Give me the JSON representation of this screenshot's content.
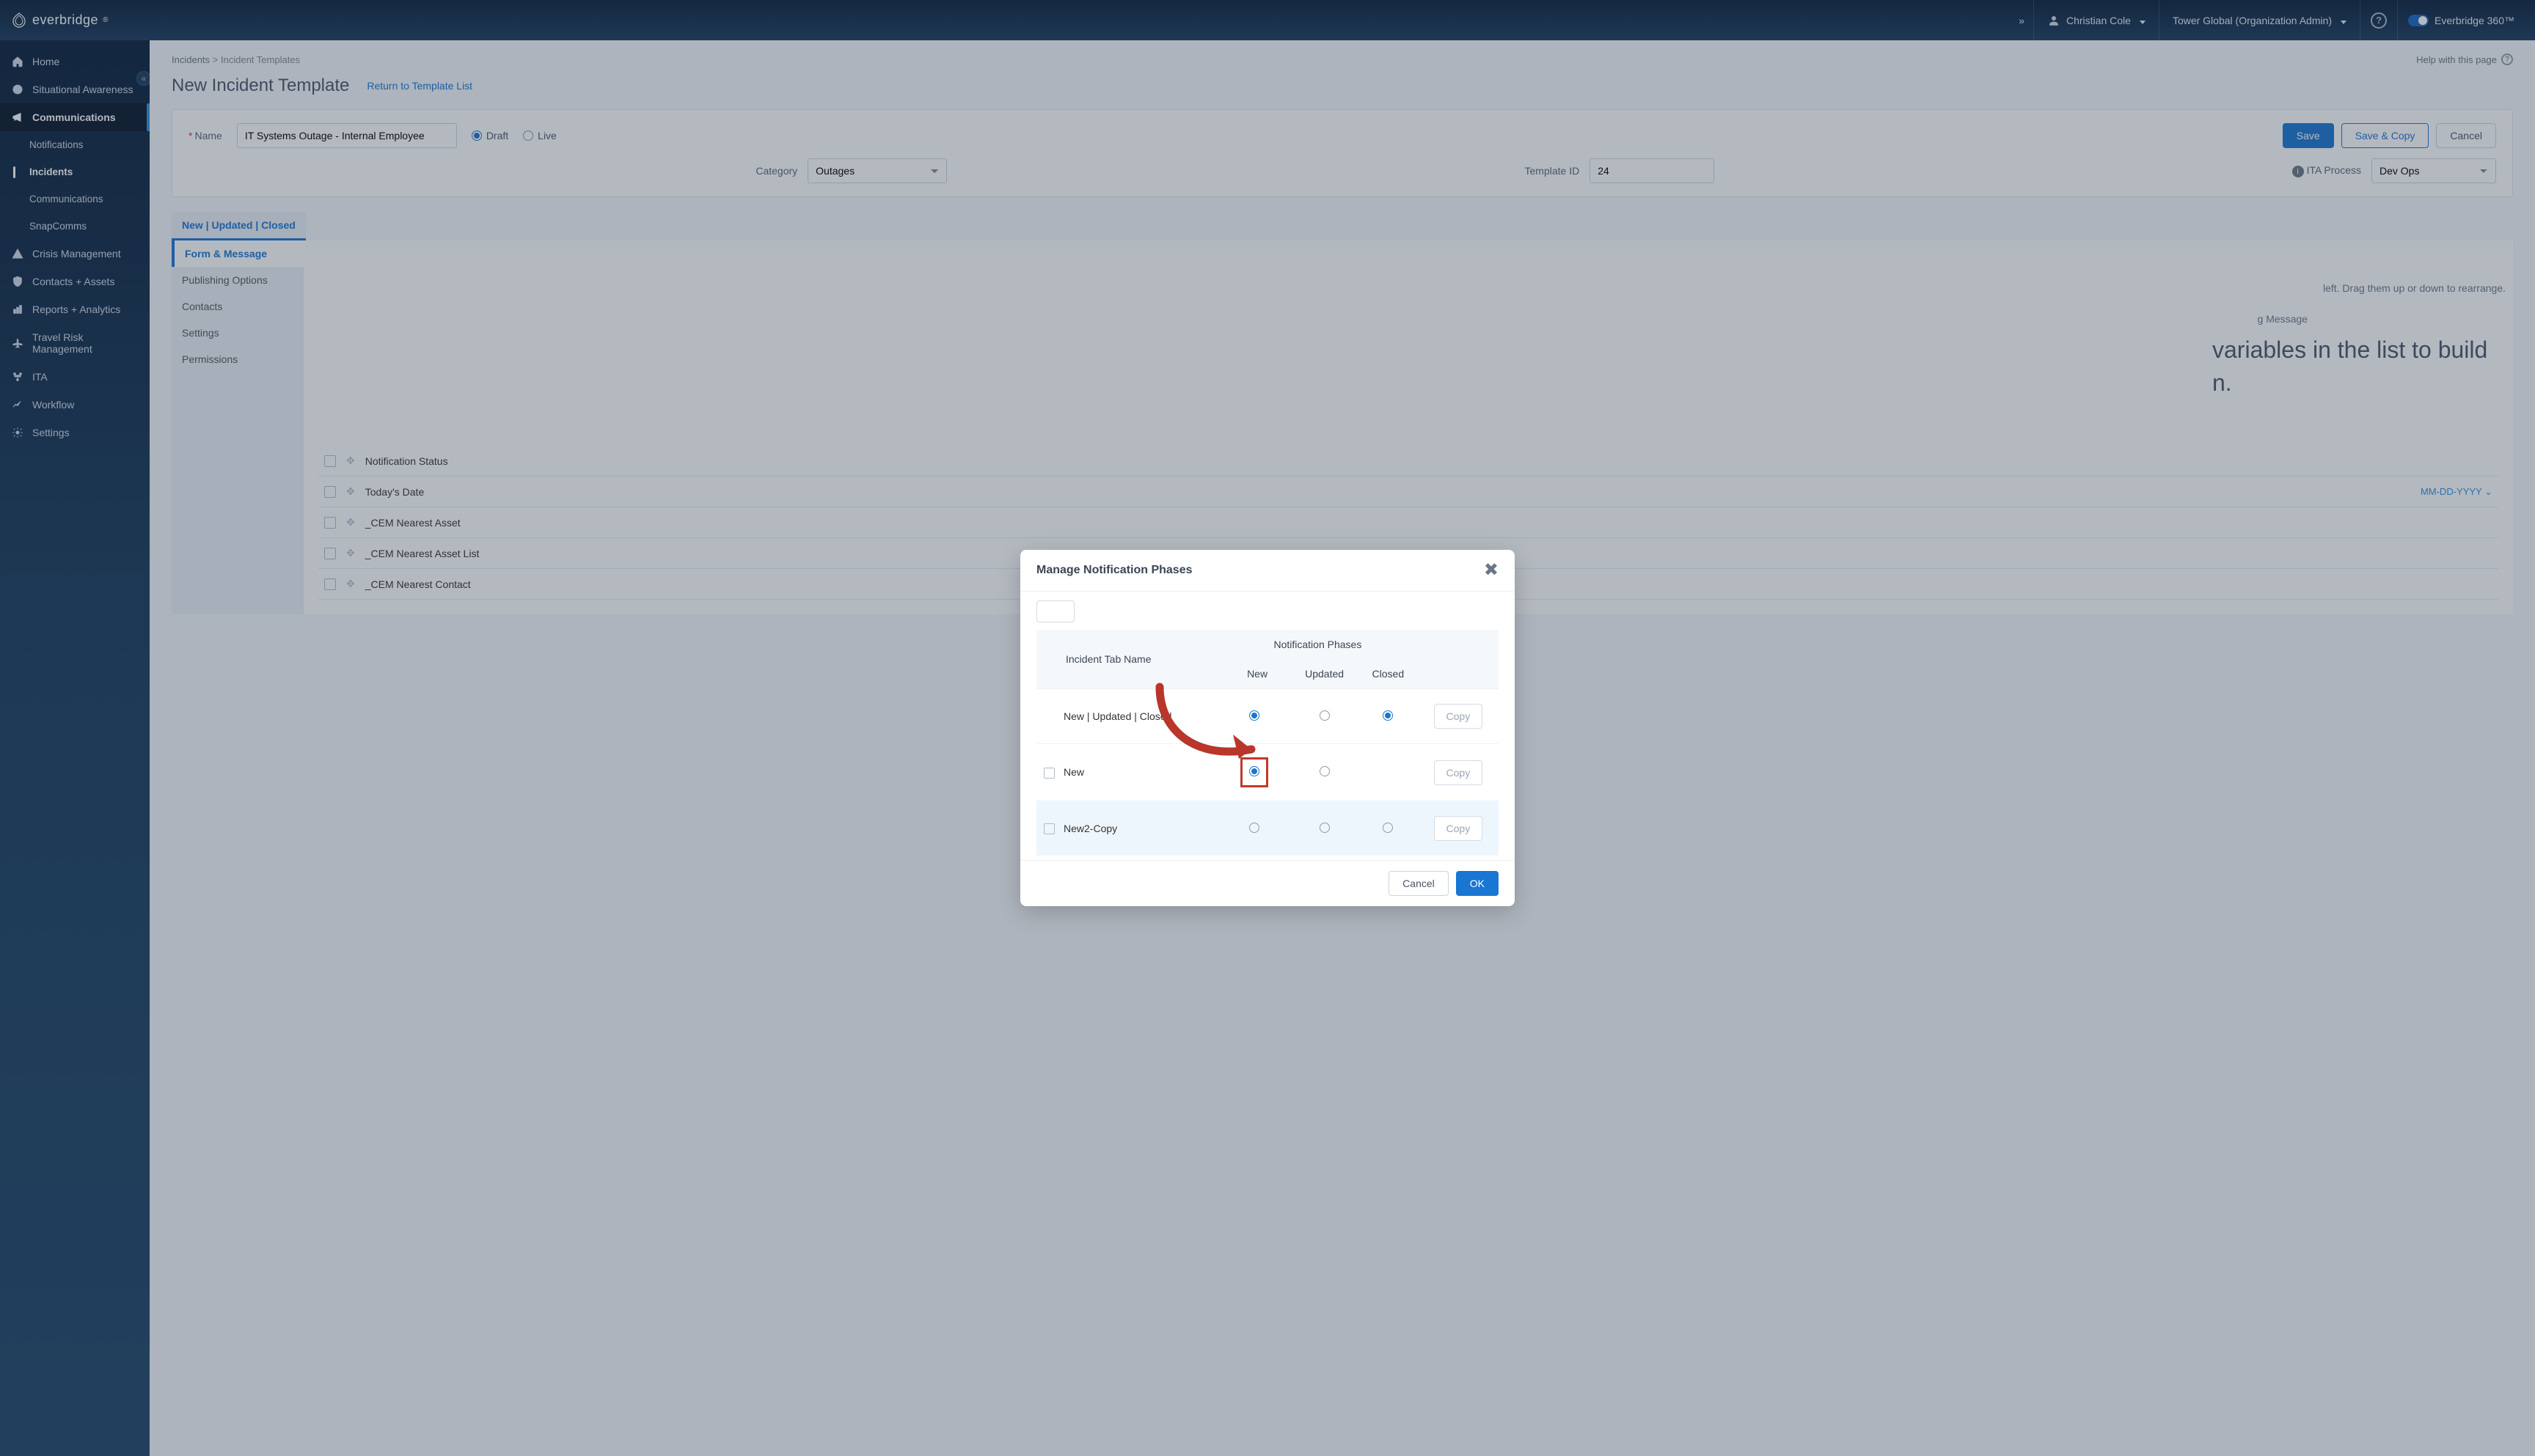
{
  "brand": {
    "name": "everbridge",
    "product": "Everbridge 360™"
  },
  "user": {
    "name": "Christian Cole"
  },
  "org": {
    "label": "Tower Global (Organization Admin)"
  },
  "sidebar": {
    "items": [
      {
        "label": "Home"
      },
      {
        "label": "Situational Awareness"
      },
      {
        "label": "Communications"
      },
      {
        "label": "Notifications"
      },
      {
        "label": "Incidents"
      },
      {
        "label": "Communications"
      },
      {
        "label": "SnapComms"
      },
      {
        "label": "Crisis Management"
      },
      {
        "label": "Contacts + Assets"
      },
      {
        "label": "Reports + Analytics"
      },
      {
        "label": "Travel Risk Management"
      },
      {
        "label": "ITA"
      },
      {
        "label": "Workflow"
      },
      {
        "label": "Settings"
      }
    ]
  },
  "breadcrumb": {
    "root": "Incidents",
    "sep": ">",
    "current": "Incident Templates"
  },
  "help": {
    "page": "Help with this page"
  },
  "page": {
    "title": "New Incident Template",
    "return_link": "Return to Template List"
  },
  "form": {
    "name_label": "Name",
    "name_value": "IT Systems Outage - Internal Employee",
    "draft": "Draft",
    "live": "Live",
    "save": "Save",
    "save_copy": "Save & Copy",
    "cancel": "Cancel",
    "category_label": "Category",
    "category_value": "Outages",
    "template_id_label": "Template ID",
    "template_id_value": "24",
    "ita_label": "ITA Process",
    "ita_value": "Dev Ops"
  },
  "tabs": {
    "main": "New | Updated | Closed"
  },
  "subnav": {
    "items": [
      {
        "label": "Form & Message"
      },
      {
        "label": "Publishing Options"
      },
      {
        "label": "Contacts"
      },
      {
        "label": "Settings"
      },
      {
        "label": "Permissions"
      }
    ]
  },
  "hint": "left. Drag them up or down to rearrange.",
  "outgoing": "g Message",
  "big_msg": "variables in the list to build n.",
  "vars": [
    {
      "label": "Notification Status"
    },
    {
      "label": "Today's Date",
      "format": "MM-DD-YYYY"
    },
    {
      "label": "_CEM Nearest Asset"
    },
    {
      "label": "_CEM Nearest Asset List"
    },
    {
      "label": "_CEM Nearest Contact"
    }
  ],
  "modal": {
    "title": "Manage Notification Phases",
    "group_header": "Notification Phases",
    "col_tab": "Incident Tab Name",
    "col_new": "New",
    "col_updated": "Updated",
    "col_closed": "Closed",
    "rows": [
      {
        "name": "New | Updated | Closed",
        "new": true,
        "updated": false,
        "closed": true,
        "checkbox": false
      },
      {
        "name": "New",
        "new": true,
        "updated": false,
        "closed": false,
        "highlight": true,
        "checkbox": true
      },
      {
        "name": "New2-Copy",
        "new": false,
        "updated": false,
        "closed": false,
        "checkbox": true
      }
    ],
    "copy": "Copy",
    "cancel": "Cancel",
    "ok": "OK"
  }
}
